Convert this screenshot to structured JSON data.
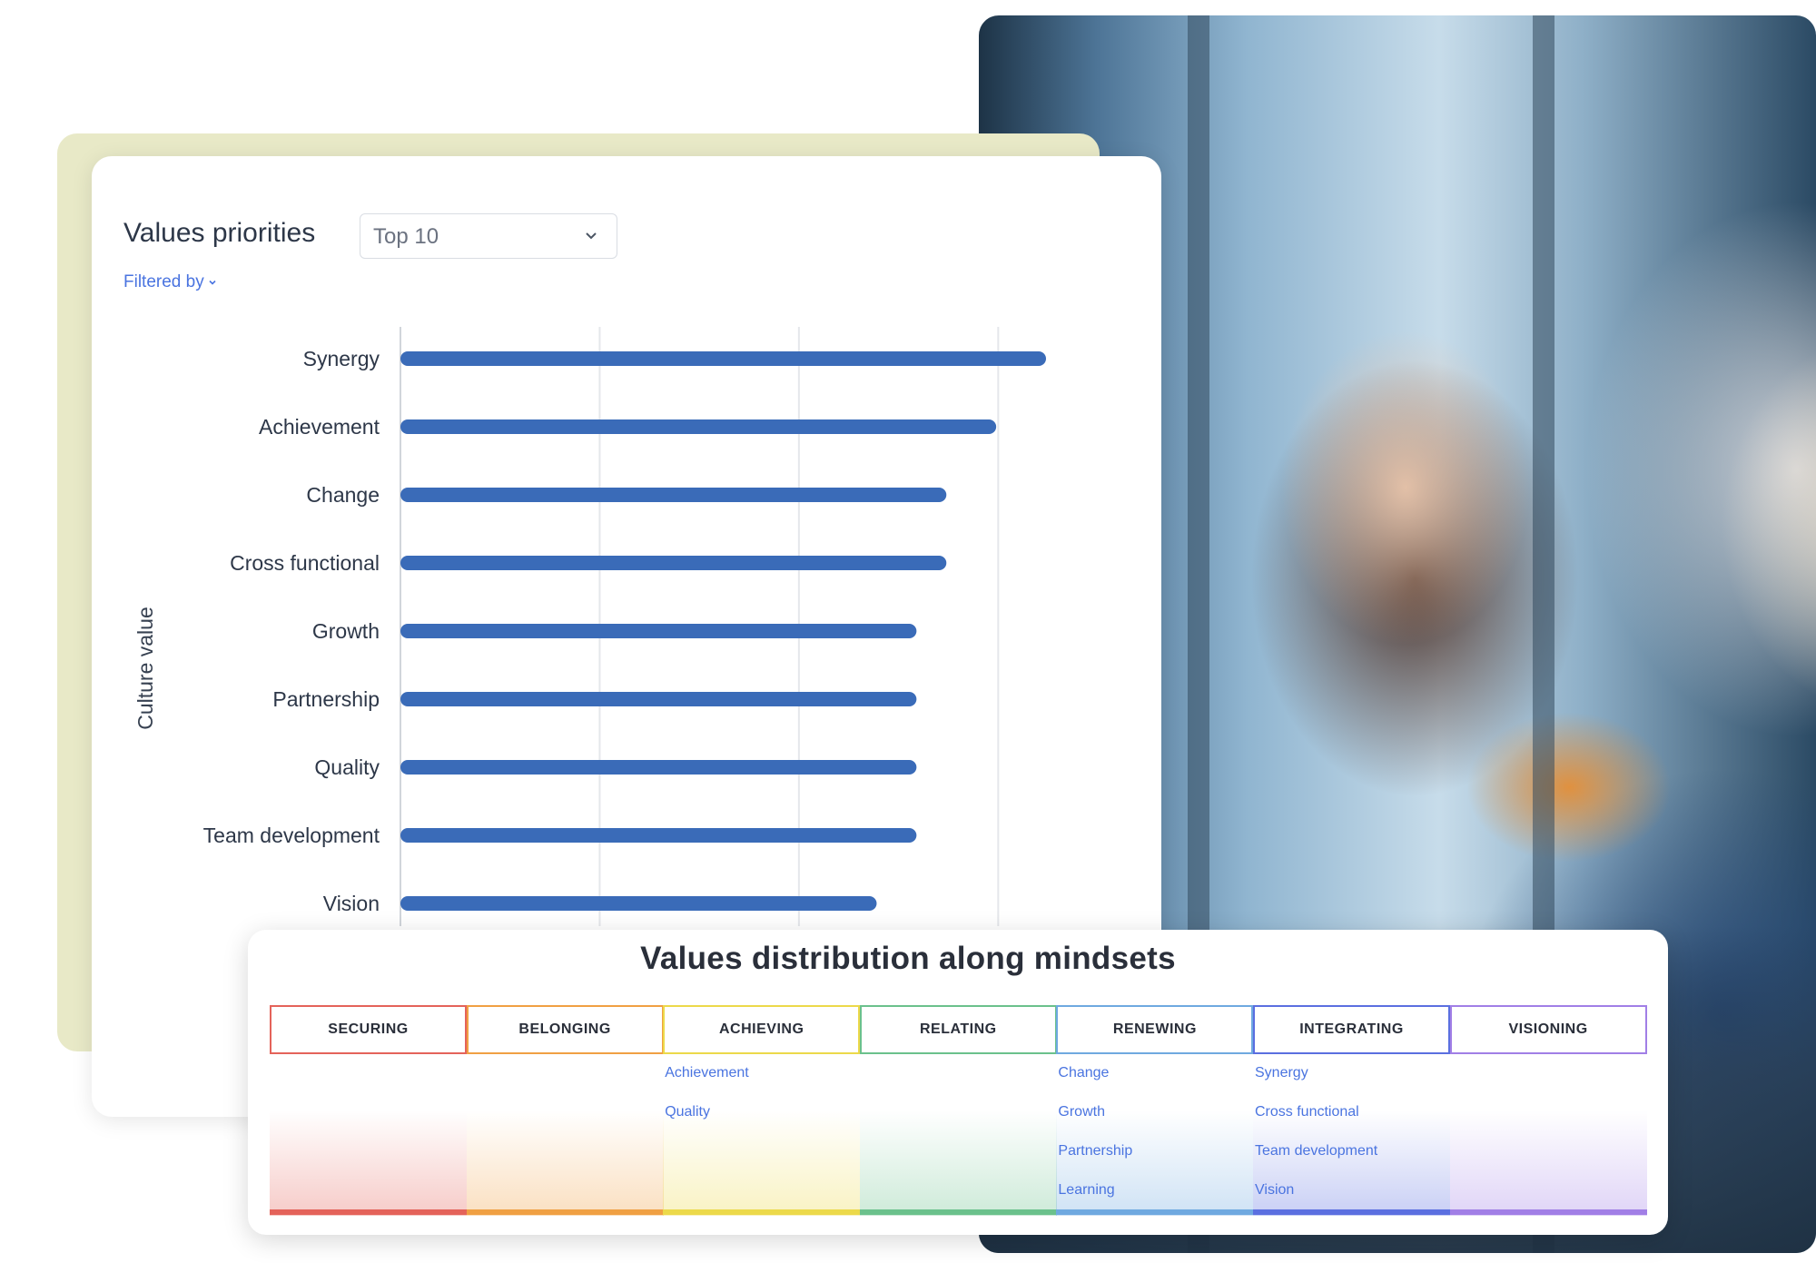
{
  "panel": {
    "title": "Values priorities",
    "dropdown_value": "Top 10",
    "filter_label": "Filtered by"
  },
  "chart_data": {
    "type": "bar",
    "orientation": "horizontal",
    "ylabel": "Culture value",
    "categories": [
      "Synergy",
      "Achievement",
      "Change",
      "Cross functional",
      "Growth",
      "Partnership",
      "Quality",
      "Team development",
      "Vision"
    ],
    "values": [
      3.24,
      2.99,
      2.74,
      2.74,
      2.59,
      2.59,
      2.59,
      2.59,
      2.39
    ],
    "xlim": [
      0,
      3.6
    ],
    "grid": true,
    "bar_color": "#3a6bb8"
  },
  "distribution": {
    "title": "Values distribution along mindsets",
    "mindsets": [
      {
        "label": "SECURING",
        "color": "#e4635a",
        "items": []
      },
      {
        "label": "BELONGING",
        "color": "#f0a043",
        "items": []
      },
      {
        "label": "ACHIEVING",
        "color": "#ecd94a",
        "items": [
          "Achievement",
          "Quality"
        ]
      },
      {
        "label": "RELATING",
        "color": "#6bc18c",
        "items": []
      },
      {
        "label": "RENEWING",
        "color": "#6fa9e0",
        "items": [
          "Change",
          "Growth",
          "Partnership",
          "Learning"
        ]
      },
      {
        "label": "INTEGRATING",
        "color": "#5b6fe0",
        "items": [
          "Synergy",
          "Cross functional",
          "Team development",
          "Vision"
        ]
      },
      {
        "label": "VISIONING",
        "color": "#a17fe6",
        "items": []
      }
    ]
  }
}
